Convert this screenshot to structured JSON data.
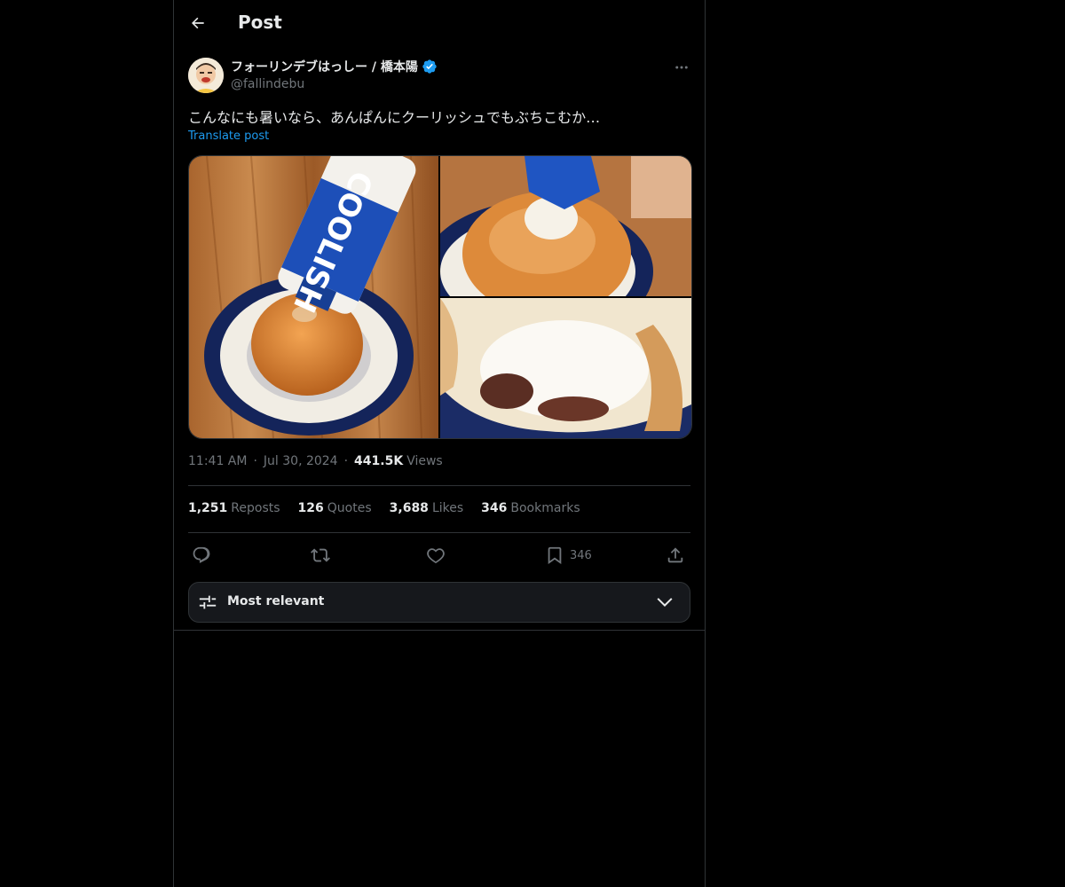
{
  "header": {
    "title": "Post"
  },
  "author": {
    "display_name": "フォーリンデブはっしー / 橋本陽",
    "handle": "@fallindebu",
    "verified": true
  },
  "post": {
    "text": "こんなにも暑いなら、あんぱんにクーリッシュでもぶちこむか…",
    "translate_label": "Translate post",
    "media_count": 3
  },
  "meta": {
    "time": "11:41 AM",
    "date": "Jul 30, 2024",
    "views_count": "441.5K",
    "views_label": "Views"
  },
  "stats": [
    {
      "count": "1,251",
      "label": "Reposts"
    },
    {
      "count": "126",
      "label": "Quotes"
    },
    {
      "count": "3,688",
      "label": "Likes"
    },
    {
      "count": "346",
      "label": "Bookmarks"
    }
  ],
  "actions": {
    "bookmark_count": "346"
  },
  "sort": {
    "label": "Most relevant"
  },
  "colors": {
    "background": "#000000",
    "accent": "#1d9bf0",
    "muted": "#71767b",
    "text": "#e7e9ea",
    "border": "#2f3336"
  }
}
